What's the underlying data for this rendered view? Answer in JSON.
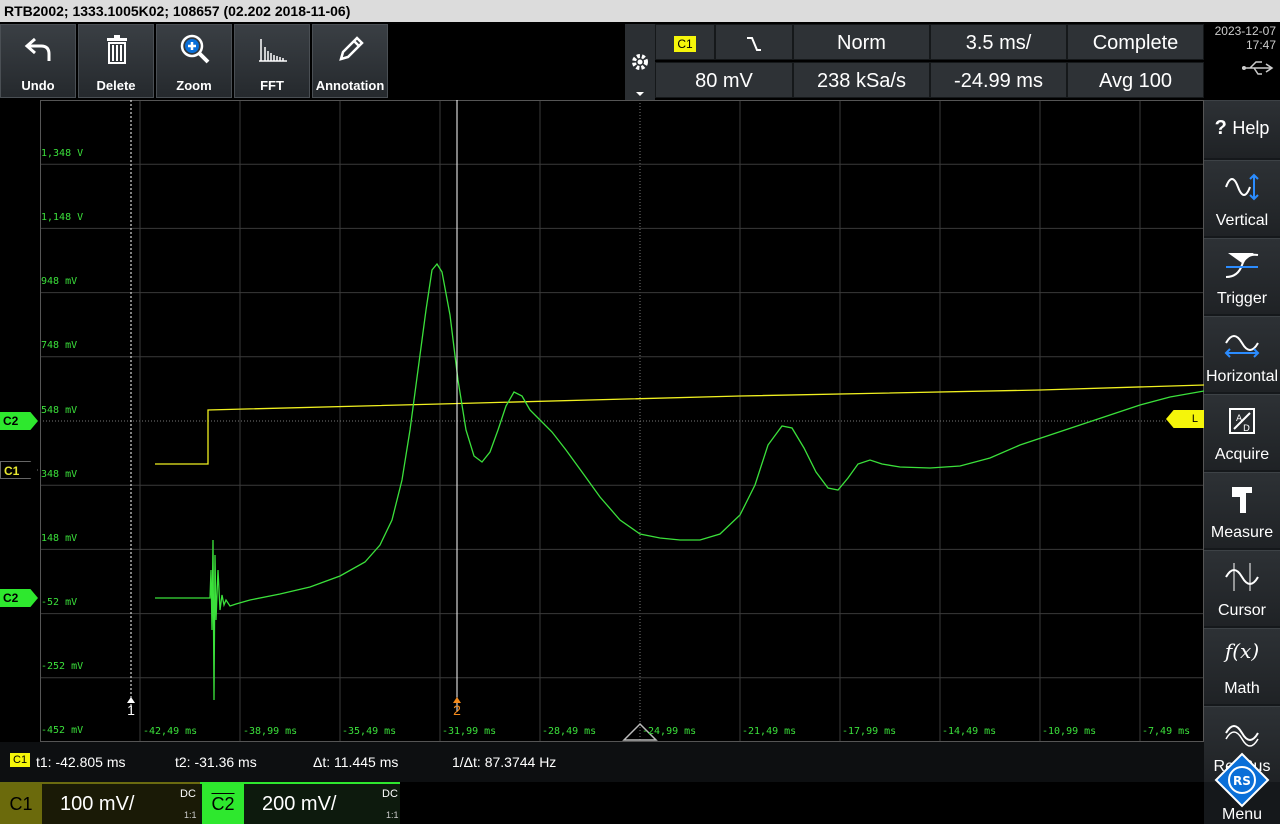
{
  "title": "RTB2002; 1333.1005K02; 108657 (02.202 2018-11-06)",
  "toolbar": {
    "buttons": [
      {
        "label": "Undo",
        "icon": "undo-icon"
      },
      {
        "label": "Delete",
        "icon": "trash-icon"
      },
      {
        "label": "Zoom",
        "icon": "zoom-icon"
      },
      {
        "label": "FFT",
        "icon": "fft-icon"
      },
      {
        "label": "Annotation",
        "icon": "pencil-icon"
      }
    ]
  },
  "status": {
    "trigger_source": "C1",
    "trigger_level": "80 mV",
    "trigger_mode": "Norm",
    "sample_rate": "238 kSa/s",
    "timebase": "3.5 ms/",
    "position": "-24.99 ms",
    "acq_state": "Complete",
    "acq_mode": "Avg 100"
  },
  "datetime": {
    "date": "2023-12-07",
    "time": "17:47"
  },
  "y_labels": [
    "1,348 V",
    "1,148 V",
    "948 mV",
    "748 mV",
    "548 mV",
    "348 mV",
    "148 mV",
    "-52 mV",
    "-252 mV",
    "-452 mV"
  ],
  "x_labels": [
    "-42,49 ms",
    "-38,99 ms",
    "-35,49 ms",
    "-31,99 ms",
    "-28,49 ms",
    "-24,99 ms",
    "-21,49 ms",
    "-17,99 ms",
    "-14,49 ms",
    "-10,99 ms",
    "-7,49 ms"
  ],
  "markers": {
    "c2": "C2",
    "c1": "C1",
    "c2b": "C2",
    "trigger_level": "L",
    "cursor1": "1",
    "cursor2": "2"
  },
  "sidebar": {
    "items": [
      {
        "label": "Help",
        "icon": "help-icon"
      },
      {
        "label": "Vertical",
        "icon": "vertical-icon"
      },
      {
        "label": "Trigger",
        "icon": "trigger-icon"
      },
      {
        "label": "Horizontal",
        "icon": "horizontal-icon"
      },
      {
        "label": "Acquire",
        "icon": "acquire-icon"
      },
      {
        "label": "Measure",
        "icon": "measure-icon"
      },
      {
        "label": "Cursor",
        "icon": "cursor-icon"
      },
      {
        "label": "Math",
        "icon": "math-icon"
      },
      {
        "label": "Ref/Bus",
        "icon": "ref-icon"
      }
    ],
    "menu_label": "Menu"
  },
  "cursors": {
    "source": "C1",
    "t1": "t1: -42.805 ms",
    "t2": "t2: -31.36 ms",
    "dt": "Δt: 11.445 ms",
    "inv_dt": "1/Δt: 87.3744 Hz"
  },
  "channels": [
    {
      "name": "C1",
      "scale": "100 mV/",
      "coupling": "DC",
      "probe": "1:1",
      "color": "#f5f50a"
    },
    {
      "name": "C2",
      "scale": "200 mV/",
      "coupling": "DC",
      "probe": "1:1",
      "color": "#2ee82e"
    }
  ],
  "colors": {
    "ch1": "#f0f020",
    "ch2": "#3be03b",
    "accent": "#0a6fd8",
    "trigger": "#f5f50a"
  }
}
